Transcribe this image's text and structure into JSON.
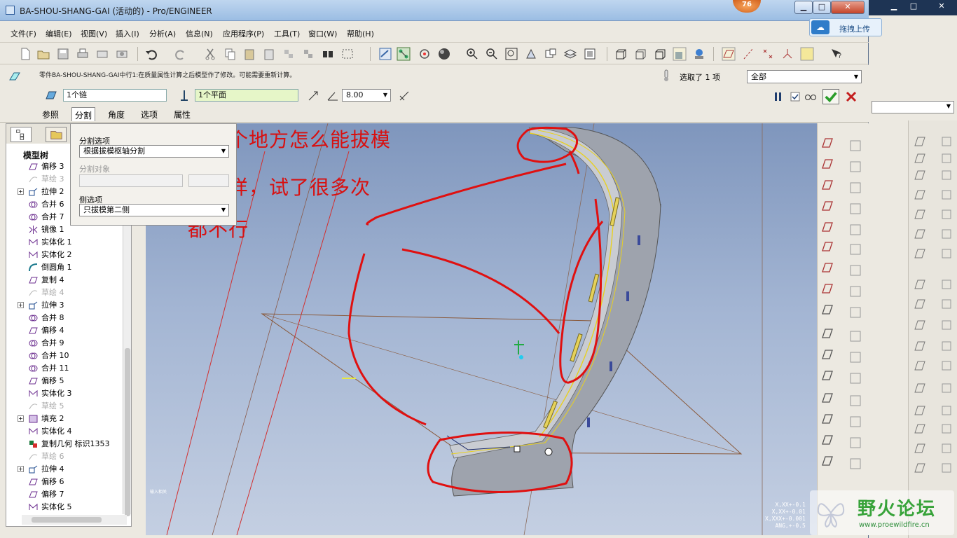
{
  "window": {
    "title": "BA-SHOU-SHANG-GAI (活动的) - Pro/ENGINEER",
    "badge": "76",
    "min": "▁",
    "max": "□",
    "close": "✕"
  },
  "menu": [
    "文件(F)",
    "编辑(E)",
    "视图(V)",
    "插入(I)",
    "分析(A)",
    "信息(N)",
    "应用程序(P)",
    "工具(T)",
    "窗口(W)",
    "帮助(H)"
  ],
  "dashboard": {
    "message": "零件BA-SHOU-SHANG-GAI中行1:在质量属性计算之后模型作了修改。可能需要重新计算。",
    "surface_field": "1个链",
    "pivot_field": "1个平面",
    "angle_value": "8.00",
    "selected_label": "选取了 1 项",
    "filter": "全部",
    "tabs": [
      "参照",
      "分割",
      "角度",
      "选项",
      "属性"
    ]
  },
  "split_panel": {
    "split_options_label": "分割选项",
    "split_options_value": "根据拔模枢轴分割",
    "split_object_label": "分割对象",
    "split_object_value": "",
    "side_options_label": "侧选项",
    "side_options_value": "只拔模第二侧"
  },
  "tree": {
    "heading": "模型树",
    "items": [
      {
        "label": "偏移 3",
        "icon": "offset",
        "dim": false,
        "exp": false
      },
      {
        "label": "草绘 3",
        "icon": "sketch",
        "dim": true,
        "exp": false
      },
      {
        "label": "拉伸 2",
        "icon": "extrude",
        "dim": false,
        "exp": true
      },
      {
        "label": "合并 6",
        "icon": "merge",
        "dim": false,
        "exp": false
      },
      {
        "label": "合并 7",
        "icon": "merge",
        "dim": false,
        "exp": false
      },
      {
        "label": "镜像 1",
        "icon": "mirror",
        "dim": false,
        "exp": false
      },
      {
        "label": "实体化 1",
        "icon": "solidify",
        "dim": false,
        "exp": false
      },
      {
        "label": "实体化 2",
        "icon": "solidify",
        "dim": false,
        "exp": false
      },
      {
        "label": "倒圆角 1",
        "icon": "round",
        "dim": false,
        "exp": false
      },
      {
        "label": "复制 4",
        "icon": "copy",
        "dim": false,
        "exp": false
      },
      {
        "label": "草绘 4",
        "icon": "sketch",
        "dim": true,
        "exp": false
      },
      {
        "label": "拉伸 3",
        "icon": "extrude",
        "dim": false,
        "exp": true
      },
      {
        "label": "合并 8",
        "icon": "merge",
        "dim": false,
        "exp": false
      },
      {
        "label": "偏移 4",
        "icon": "offset",
        "dim": false,
        "exp": false
      },
      {
        "label": "合并 9",
        "icon": "merge",
        "dim": false,
        "exp": false
      },
      {
        "label": "合并 10",
        "icon": "merge",
        "dim": false,
        "exp": false
      },
      {
        "label": "合并 11",
        "icon": "merge",
        "dim": false,
        "exp": false
      },
      {
        "label": "偏移 5",
        "icon": "offset",
        "dim": false,
        "exp": false
      },
      {
        "label": "实体化 3",
        "icon": "solidify",
        "dim": false,
        "exp": false
      },
      {
        "label": "草绘 5",
        "icon": "sketch",
        "dim": true,
        "exp": false
      },
      {
        "label": "填充 2",
        "icon": "fill",
        "dim": false,
        "exp": true
      },
      {
        "label": "实体化 4",
        "icon": "solidify",
        "dim": false,
        "exp": false
      },
      {
        "label": "复制几何 标识1353",
        "icon": "copygeom",
        "dim": false,
        "exp": false
      },
      {
        "label": "草绘 6",
        "icon": "sketch",
        "dim": true,
        "exp": false
      },
      {
        "label": "拉伸 4",
        "icon": "extrude",
        "dim": false,
        "exp": true
      },
      {
        "label": "偏移 6",
        "icon": "offset",
        "dim": false,
        "exp": false
      },
      {
        "label": "偏移 7",
        "icon": "offset",
        "dim": false,
        "exp": false
      },
      {
        "label": "实体化 5",
        "icon": "solidify",
        "dim": false,
        "exp": false
      }
    ]
  },
  "annotations": [
    "这三个地方怎么能拔模",
    "都一样，试了很多次",
    "都不行"
  ],
  "viewport": {
    "coords": [
      "X,XX+-0.1",
      "X,XX+-0.01",
      "X,XXX+-0.001",
      "ANG,+-0.5"
    ],
    "corner_text": "输入相关"
  },
  "upload": {
    "label": "拖拽上传"
  },
  "watermark": {
    "name": "野火论坛",
    "url": "www.proewildfire.cn"
  },
  "colors": {
    "annotation": "#d81010",
    "accept": "#2a9d2a",
    "cancel": "#c41e1e",
    "watermark": "#38a33a"
  }
}
